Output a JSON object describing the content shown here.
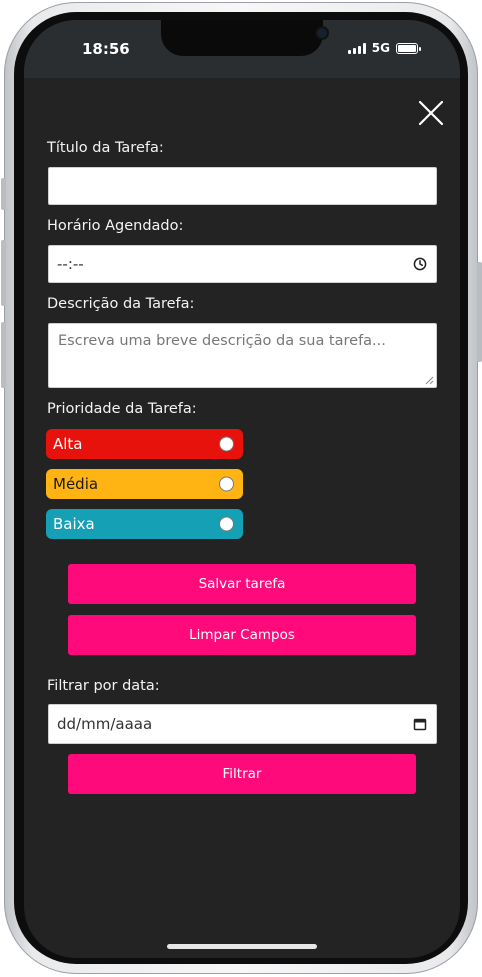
{
  "status_bar": {
    "time": "18:56",
    "network": "5G"
  },
  "form": {
    "title_label": "Título da Tarefa:",
    "title_value": "",
    "time_label": "Horário Agendado:",
    "time_value": "--:--",
    "description_label": "Descrição da Tarefa:",
    "description_placeholder": "Escreva uma breve descrição da sua tarefa...",
    "priority_label": "Prioridade da Tarefa:",
    "priorities": [
      {
        "label": "Alta",
        "color": "#e8120c",
        "text_color": "#ffffff"
      },
      {
        "label": "Média",
        "color": "#ffb414",
        "text_color": "#1a1a1a"
      },
      {
        "label": "Baixa",
        "color": "#16a0b6",
        "text_color": "#ffffff"
      }
    ],
    "save_button": "Salvar tarefa",
    "clear_button": "Limpar Campos",
    "filter_label": "Filtrar por data:",
    "filter_date_value": "dd/mm/aaaa",
    "filter_button": "Filtrar"
  },
  "colors": {
    "accent": "#ff0a7b",
    "background": "#232323"
  }
}
